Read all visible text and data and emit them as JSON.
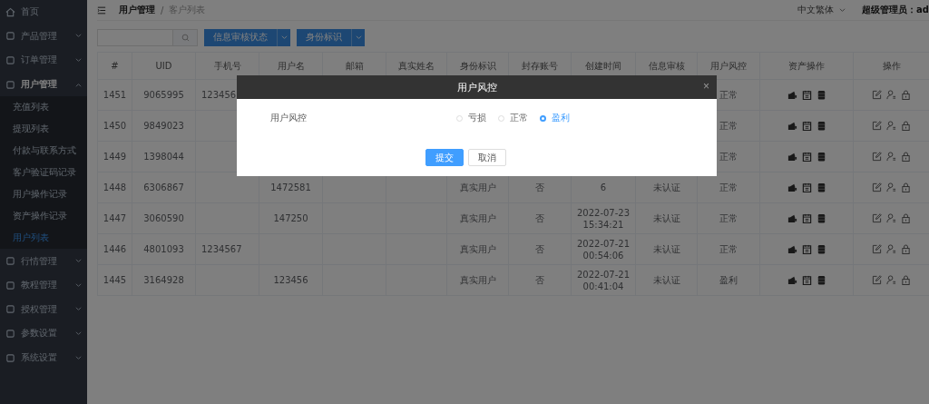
{
  "sidebar": {
    "items": [
      {
        "kind": "link",
        "label": "首页"
      },
      {
        "kind": "group",
        "label": "产品管理",
        "expanded": false
      },
      {
        "kind": "group",
        "label": "订单管理",
        "expanded": false
      },
      {
        "kind": "group",
        "label": "用户管理",
        "expanded": true,
        "children": [
          {
            "label": "充值列表",
            "selected": false
          },
          {
            "label": "提现列表",
            "selected": false
          },
          {
            "label": "付款与联系方式",
            "selected": false
          },
          {
            "label": "客户验证码记录",
            "selected": false
          },
          {
            "label": "用户操作记录",
            "selected": false
          },
          {
            "label": "资产操作记录",
            "selected": false
          },
          {
            "label": "用户列表",
            "selected": true
          }
        ]
      },
      {
        "kind": "group",
        "label": "行情管理",
        "expanded": false
      },
      {
        "kind": "group",
        "label": "教程管理",
        "expanded": false
      },
      {
        "kind": "group",
        "label": "授权管理",
        "expanded": false
      },
      {
        "kind": "group",
        "label": "参数设置",
        "expanded": false
      },
      {
        "kind": "group",
        "label": "系统设置",
        "expanded": false
      }
    ]
  },
  "breadcrumb": {
    "items": [
      "用户管理",
      "客户列表"
    ],
    "separator": "/"
  },
  "header": {
    "language": "中文繁体",
    "user": "超级管理员：ad"
  },
  "toolbar": {
    "filters": [
      "信息审核状态",
      "身份标识"
    ]
  },
  "table": {
    "columns": [
      "#",
      "UID",
      "手机号",
      "用户名",
      "邮箱",
      "真实姓名",
      "身份标识",
      "封存账号",
      "创建时间",
      "信息审核",
      "用户风控",
      "资产操作",
      "操作"
    ],
    "rows": [
      {
        "no": "1451",
        "uid": "9065995",
        "phone": "123456",
        "risk": "正常"
      },
      {
        "no": "1450",
        "uid": "9849023",
        "risk": "正常"
      },
      {
        "no": "1449",
        "uid": "1398044",
        "risk": "正常"
      },
      {
        "no": "1448",
        "uid": "6306867",
        "username": "1472581",
        "identity": "真实用户",
        "sealed": "否",
        "created": "6",
        "review": "未认证",
        "risk": "正常"
      },
      {
        "no": "1447",
        "uid": "3060590",
        "username": "147250",
        "identity": "真实用户",
        "sealed": "否",
        "created": "2022-07-23 15:34:21",
        "review": "未认证",
        "risk": "正常"
      },
      {
        "no": "1446",
        "uid": "4801093",
        "phone": "1234567",
        "identity": "真实用户",
        "sealed": "否",
        "created": "2022-07-21 00:54:06",
        "review": "未认证",
        "risk": "正常"
      },
      {
        "no": "1445",
        "uid": "3164928",
        "username": "123456",
        "identity": "真实用户",
        "sealed": "否",
        "created": "2022-07-21 00:41:04",
        "review": "未认证",
        "risk": "盈利"
      }
    ]
  },
  "dialog": {
    "title": "用户风控",
    "close": "×",
    "field_label": "用户风控",
    "options": [
      {
        "label": "亏损",
        "selected": false
      },
      {
        "label": "正常",
        "selected": false
      },
      {
        "label": "盈利",
        "selected": true
      }
    ],
    "buttons": [
      {
        "kind": "primary",
        "label": "提交"
      },
      {
        "kind": "default",
        "label": "取消"
      }
    ]
  }
}
